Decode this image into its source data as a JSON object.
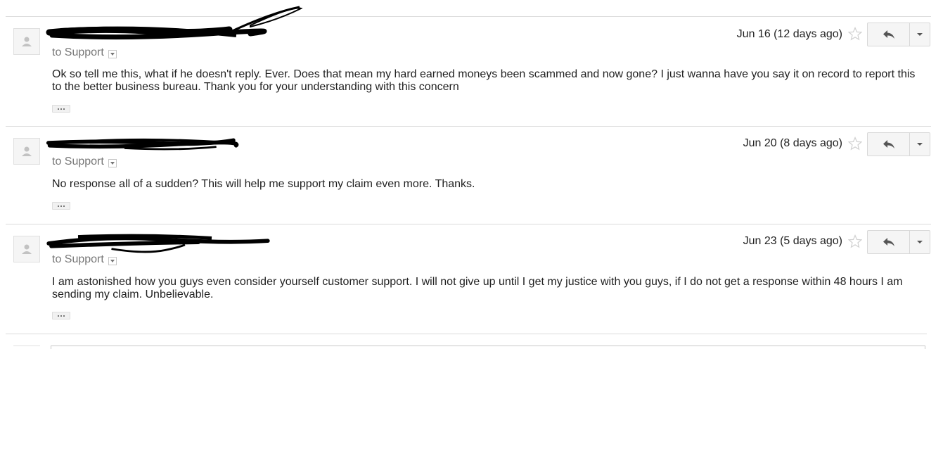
{
  "messages": [
    {
      "recipient": "to Support",
      "date": "Jun 16 (12 days ago)",
      "body": "Ok so tell me this, what if he doesn't reply. Ever. Does that mean my hard earned moneys been scammed and now gone? I just wanna have you say it on record to report this to the better business bureau. Thank you for your understanding with this concern"
    },
    {
      "recipient": "to Support",
      "date": "Jun 20 (8 days ago)",
      "body": "No response all of a sudden? This will help me support my claim even more. Thanks."
    },
    {
      "recipient": "to Support",
      "date": "Jun 23 (5 days ago)",
      "body": "I am astonished how you guys even consider yourself customer support. I will not give up until I get my justice with you guys, if I do not get a response within 48 hours I am sending my claim. Unbelievable."
    }
  ],
  "icons": {
    "avatar": "default-avatar-icon",
    "star": "star-outline-icon",
    "reply": "reply-arrow-icon",
    "more": "caret-down-icon",
    "recipient_details": "small-caret-down-icon",
    "show_trimmed": "ellipsis-icon"
  },
  "colors": {
    "text": "#222222",
    "muted": "#777777",
    "border": "#dcdcdc",
    "button_bg": "#f5f5f5",
    "redaction": "#000000"
  }
}
